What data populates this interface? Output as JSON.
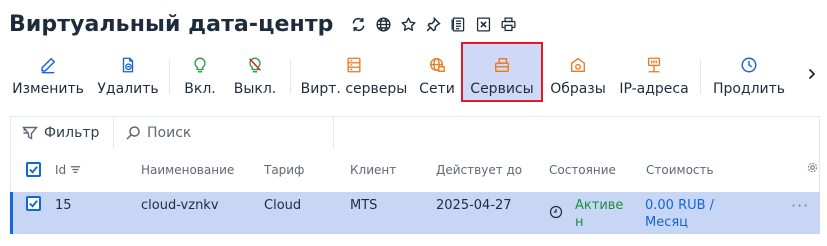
{
  "page": {
    "title": "Виртуальный дата-центр",
    "title_icons": [
      "refresh-icon",
      "globe-icon",
      "star-icon",
      "pin-icon",
      "document-icon",
      "excel-icon",
      "print-icon"
    ]
  },
  "toolbar": {
    "edit": "Изменить",
    "delete": "Удалить",
    "on": "Вкл.",
    "off": "Выкл.",
    "virtual_servers": "Вирт. серверы",
    "networks": "Сети",
    "services": "Сервисы",
    "images": "Образы",
    "ip_addresses": "IP-адреса",
    "extend": "Продлить",
    "active_item": "services"
  },
  "filterbar": {
    "filter_label": "Фильтр",
    "search_placeholder": "Поиск"
  },
  "table": {
    "columns": {
      "id": "Id",
      "name": "Наименование",
      "tariff": "Тариф",
      "client": "Клиент",
      "valid_until": "Действует до",
      "state": "Состояние",
      "cost": "Стоимость"
    },
    "rows": [
      {
        "id": "15",
        "name": "cloud-vznkv",
        "tariff": "Cloud",
        "client": "MTS",
        "valid_until": "2025-04-27",
        "state_line1": "Активе",
        "state_line2": "н",
        "cost_line1": "0.00 RUB /",
        "cost_line2": "Месяц",
        "selected": true
      }
    ]
  },
  "colors": {
    "accent": "#1565d8",
    "icon_orange": "#e87a1f",
    "icon_green": "#2e9e45",
    "selected_row": "#c8d6f6",
    "active_button": "#cfd8f7",
    "highlight_border": "#e01b24"
  }
}
